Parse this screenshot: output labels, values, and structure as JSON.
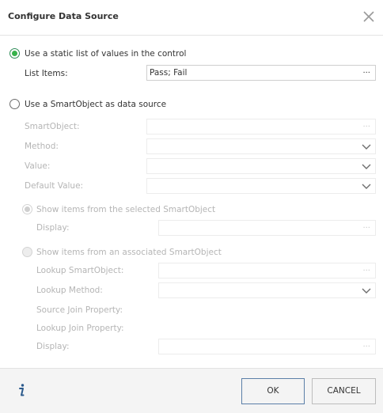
{
  "dialog": {
    "title": "Configure Data Source",
    "close_icon": "close-icon"
  },
  "static_option": {
    "label": "Use a static list of values in the control",
    "selected": true,
    "list_items_label": "List Items:",
    "list_items_value": "Pass; Fail",
    "ellipsis": "..."
  },
  "smartobject_option": {
    "label": "Use a SmartObject as data source",
    "selected": false,
    "smartobject_label": "SmartObject:",
    "method_label": "Method:",
    "value_label": "Value:",
    "default_value_label": "Default Value:",
    "ellipsis": "...",
    "show_selected": {
      "label": "Show items from the selected SmartObject",
      "display_label": "Display:"
    },
    "show_associated": {
      "label": "Show items from an associated SmartObject",
      "lookup_smartobject_label": "Lookup SmartObject:",
      "lookup_method_label": "Lookup Method:",
      "source_join_label": "Source Join Property:",
      "lookup_join_label": "Lookup Join Property:",
      "display_label": "Display:"
    }
  },
  "footer": {
    "info_icon": "info-icon",
    "ok_label": "OK",
    "cancel_label": "CANCEL"
  },
  "colors": {
    "accent_green": "#36b24a",
    "ok_border": "#5b7fa8",
    "info_blue": "#2b5a8c"
  }
}
